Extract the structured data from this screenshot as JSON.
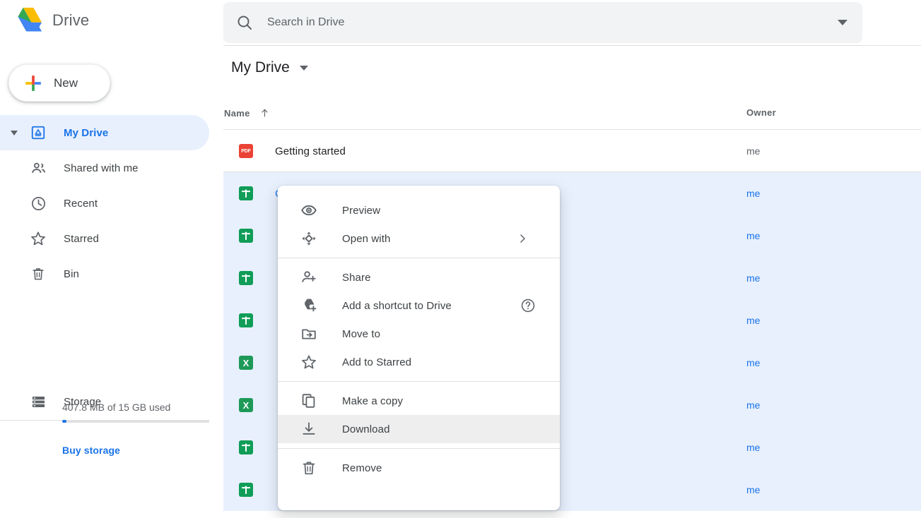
{
  "app": {
    "brand_title": "Drive",
    "logo_icon": "google-drive-logo"
  },
  "search": {
    "placeholder": "Search in Drive",
    "value": "",
    "icon": "search-icon",
    "options_icon": "chevron-down-icon"
  },
  "sidebar": {
    "new_button": {
      "label": "New",
      "icon": "plus-icon"
    },
    "items": [
      {
        "label": "My Drive",
        "icon": "my-drive-icon",
        "active": true,
        "has_caret": true
      },
      {
        "label": "Shared with me",
        "icon": "people-icon",
        "active": false,
        "has_caret": false
      },
      {
        "label": "Recent",
        "icon": "clock-icon",
        "active": false,
        "has_caret": false
      },
      {
        "label": "Starred",
        "icon": "star-icon",
        "active": false,
        "has_caret": false
      },
      {
        "label": "Bin",
        "icon": "trash-icon",
        "active": false,
        "has_caret": false
      }
    ],
    "storage": {
      "label": "Storage",
      "icon": "storage-icon",
      "used_text": "407.8 MB of 15 GB used",
      "percent": 2.7,
      "buy_label": "Buy storage",
      "accent": "#1a73e8"
    }
  },
  "main": {
    "breadcrumb": {
      "title": "My Drive",
      "caret_icon": "chevron-down-icon"
    },
    "columns": {
      "name": "Name",
      "name_sort_icon": "arrow-up-icon",
      "owner": "Owner"
    },
    "files": [
      {
        "name": "Getting started",
        "type": "pdf",
        "icon_text": "PDF",
        "owner": "me",
        "selected": false
      },
      {
        "name": "C",
        "type": "sheet",
        "icon_text": "",
        "owner": "me",
        "selected": true
      },
      {
        "name": "",
        "type": "sheet",
        "icon_text": "",
        "owner": "me",
        "selected": true
      },
      {
        "name": "",
        "type": "sheet",
        "icon_text": "",
        "owner": "me",
        "selected": true
      },
      {
        "name": "",
        "type": "sheet",
        "icon_text": "",
        "owner": "me",
        "selected": true
      },
      {
        "name": "",
        "type": "excel",
        "icon_text": "X",
        "owner": "me",
        "selected": true
      },
      {
        "name": "",
        "type": "excel",
        "icon_text": "X",
        "owner": "me",
        "selected": true
      },
      {
        "name": "",
        "type": "sheet",
        "icon_text": "",
        "owner": "me",
        "selected": true
      },
      {
        "name": "",
        "type": "sheet",
        "icon_text": "",
        "owner": "me",
        "selected": true
      }
    ]
  },
  "context_menu": {
    "groups": [
      {
        "items": [
          {
            "label": "Preview",
            "icon": "eye-icon",
            "trailing": "none",
            "hovered": false
          },
          {
            "label": "Open with",
            "icon": "open-with-icon",
            "trailing": "submenu",
            "hovered": false
          }
        ]
      },
      {
        "items": [
          {
            "label": "Share",
            "icon": "person-add-icon",
            "trailing": "none",
            "hovered": false
          },
          {
            "label": "Add a shortcut to Drive",
            "icon": "drive-add-icon",
            "trailing": "help",
            "hovered": false
          },
          {
            "label": "Move to",
            "icon": "move-to-icon",
            "trailing": "none",
            "hovered": false
          },
          {
            "label": "Add to Starred",
            "icon": "star-icon",
            "trailing": "none",
            "hovered": false
          }
        ]
      },
      {
        "items": [
          {
            "label": "Make a copy",
            "icon": "copy-icon",
            "trailing": "none",
            "hovered": false
          },
          {
            "label": "Download",
            "icon": "download-icon",
            "trailing": "none",
            "hovered": true
          }
        ]
      },
      {
        "items": [
          {
            "label": "Remove",
            "icon": "trash-icon",
            "trailing": "none",
            "hovered": false
          }
        ]
      }
    ]
  }
}
